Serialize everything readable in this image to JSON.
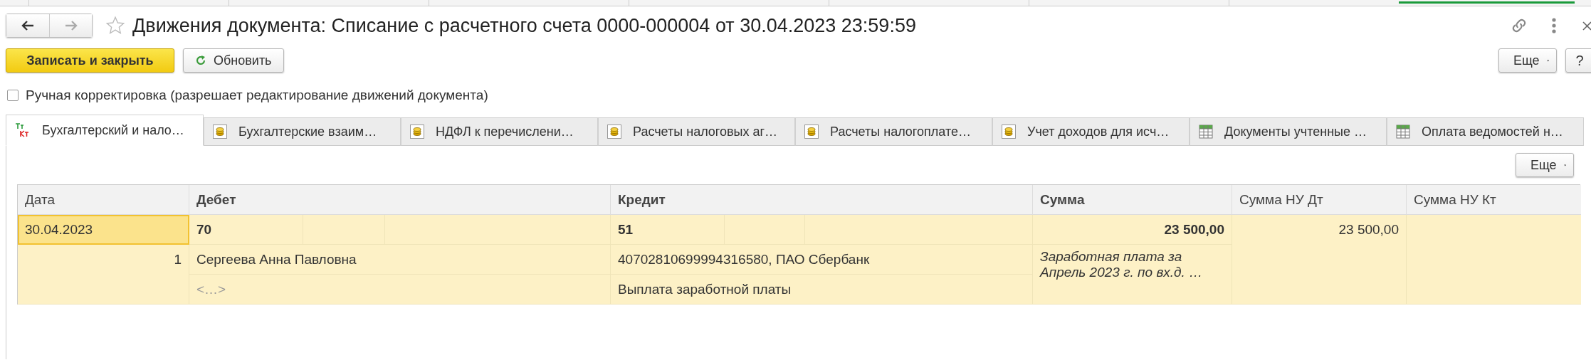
{
  "header": {
    "title": "Движения документа: Списание с расчетного счета 0000-000004 от 30.04.2023 23:59:59",
    "favorite": false
  },
  "command_bar": {
    "buttons": [
      {
        "label": "Записать и закрыть",
        "kind": "primary"
      },
      {
        "label": "Обновить",
        "kind": "refresh"
      }
    ],
    "more": "Еще",
    "help": "?"
  },
  "manual_correction": {
    "label": "Ручная корректировка (разрешает редактирование движений документа)",
    "checked": false
  },
  "tabs": [
    {
      "label": "Бухгалтерский и нало…",
      "kind": "entries",
      "selected": true
    },
    {
      "label": "Бухгалтерские взаим…",
      "kind": "register",
      "selected": false
    },
    {
      "label": "НДФЛ к перечислени…",
      "kind": "register",
      "selected": false
    },
    {
      "label": "Расчеты налоговых аг…",
      "kind": "register",
      "selected": false
    },
    {
      "label": "Расчеты налогоплате…",
      "kind": "register",
      "selected": false
    },
    {
      "label": "Учет доходов для исч…",
      "kind": "register",
      "selected": false
    },
    {
      "label": "Документы учтенные …",
      "kind": "list",
      "selected": false
    },
    {
      "label": "Оплата ведомостей н…",
      "kind": "list",
      "selected": false
    }
  ],
  "tab_more": "Еще",
  "table": {
    "columns": [
      "Дата",
      "Дебет",
      "Кредит",
      "Сумма",
      "Сумма НУ Дт",
      "Сумма НУ Кт"
    ],
    "rows": [
      {
        "selected": true,
        "date": "30.04.2023",
        "line": "1",
        "debit_account": "70",
        "debit_subconto": [
          "Сергеева Анна Павловна",
          "<…>"
        ],
        "credit_account": "51",
        "credit_subconto": [
          "40702810699994316580, ПАО Сбербанк",
          "Выплата заработной платы"
        ],
        "amount": "23 500,00",
        "comment": "Заработная плата за Апрель 2023 г. по вх.д.  …",
        "amount_nu_dt": "23 500,00"
      }
    ]
  }
}
